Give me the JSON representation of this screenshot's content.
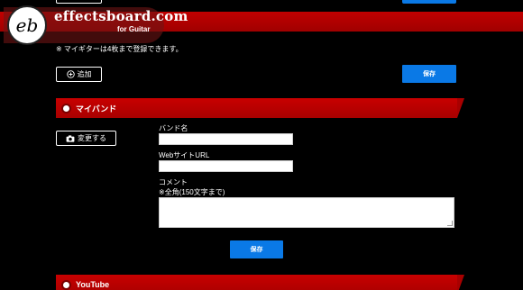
{
  "logo": {
    "mark": "eb",
    "name": "effectsboard.com",
    "tagline": "for Guitar"
  },
  "guitar_section": {
    "notice": "※ マイギターは4枚まで登録できます。",
    "add_label": "追加",
    "save_label": "保存"
  },
  "band_section": {
    "title": "マイバンド",
    "change_label": "変更する",
    "band_name_label": "バンド名",
    "band_name_value": "",
    "website_label": "WebサイトURL",
    "website_value": "",
    "comment_label": "コメント",
    "comment_hint": "※全角(150文字まで)",
    "comment_value": "",
    "save_label": "保存"
  },
  "youtube_section": {
    "title": "YouTube"
  },
  "colors": {
    "accent_red": "#c10000",
    "button_blue": "#0a79e6",
    "background": "#000000"
  }
}
